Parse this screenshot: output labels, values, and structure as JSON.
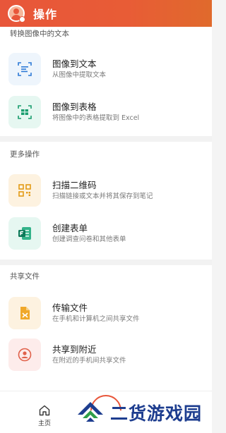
{
  "header": {
    "title": "操作"
  },
  "sections": [
    {
      "title": "转换图像中的文本",
      "items": [
        {
          "title": "图像到文本",
          "subtitle": "从图像中提取文本",
          "icon": "image-to-text-icon"
        },
        {
          "title": "图像到表格",
          "subtitle": "将图像中的表格提取到 Excel",
          "icon": "image-to-table-icon"
        }
      ]
    },
    {
      "title": "更多操作",
      "items": [
        {
          "title": "扫描二维码",
          "subtitle": "扫描链接或文本并将其保存到笔记",
          "icon": "qr-code-icon"
        },
        {
          "title": "创建表单",
          "subtitle": "创建调查问卷和其他表单",
          "icon": "forms-icon"
        }
      ]
    },
    {
      "title": "共享文件",
      "items": [
        {
          "title": "传输文件",
          "subtitle": "在手机和计算机之间共享文件",
          "icon": "transfer-file-icon"
        },
        {
          "title": "共享到附近",
          "subtitle": "在附近的手机间共享文件",
          "icon": "share-nearby-icon"
        }
      ]
    }
  ],
  "bottom_nav": {
    "home_label": "主页"
  },
  "watermark": {
    "text": "二货游戏园"
  },
  "colors": {
    "header_start": "#e8563a",
    "header_end": "#e06a2c",
    "blue_tint": "#eef5fc",
    "green_tint": "#e6f7f1",
    "orange_tint": "#fdf2e0",
    "red_tint": "#fdeceb",
    "watermark": "#1d3d8f"
  }
}
